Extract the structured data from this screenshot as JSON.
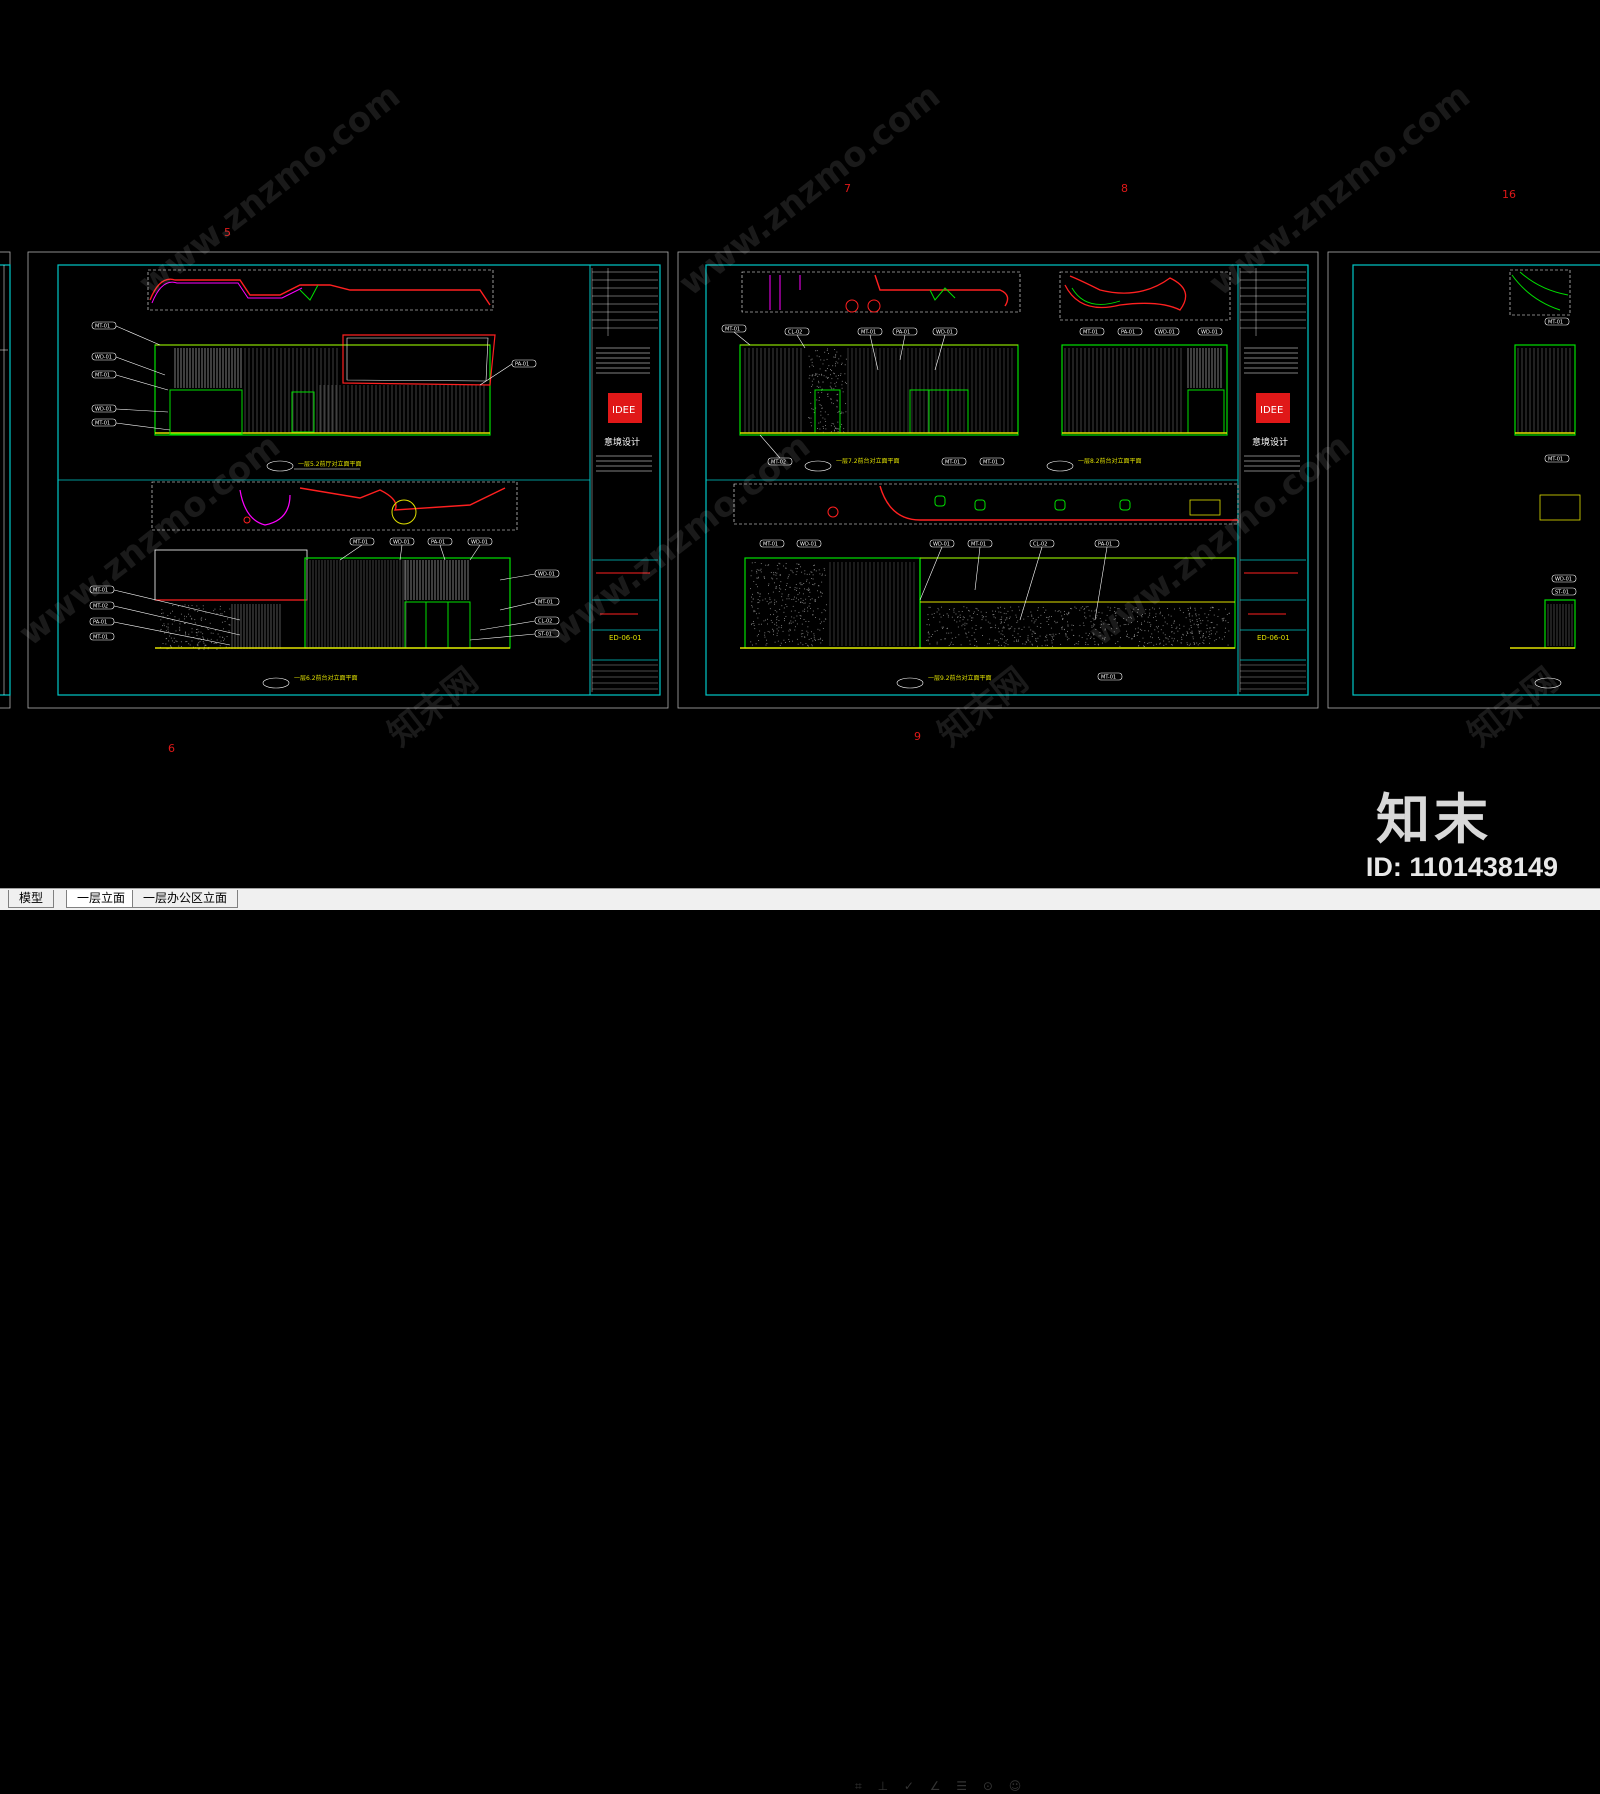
{
  "app": {
    "title": "CAD layout view"
  },
  "sheet_numbers": [
    "5",
    "6",
    "7",
    "8",
    "9",
    "16"
  ],
  "sheet_titles": {
    "s5": "一层5.2前厅对立面平面",
    "s6": "一层6.2前台对立面平面",
    "s7": "一层7.2前台对立面平面",
    "s8": "一层8.2前台对立面平面",
    "s9": "一层9.2前台对立面平面"
  },
  "brand_text": "意境设计",
  "brand_logo": "IDEE",
  "sheet_code_1": "ED-06-01",
  "sheet_code_2": "ED-06-01",
  "material_tags": [
    "MT-01",
    "WD-01",
    "PA-01",
    "CL-02",
    "ST-01",
    "MT-02"
  ],
  "watermark_text": "www.znzmo.com",
  "watermark_cn": "知末网",
  "logo_mark": "知末",
  "id_label": "ID: 1101438149",
  "tabs": [
    {
      "label": "模型"
    },
    {
      "label": "一层立面"
    },
    {
      "label": "一层办公区立面"
    }
  ],
  "status_hint": "⌗ ⊥ ✓ ∠ ☰ ⊙ ☺",
  "colors": {
    "background": "#000000",
    "frame": "#00c8c8",
    "elevation": "#00e000",
    "yellow": "#e0e000",
    "red": "#ff2020",
    "magenta": "#ff00ff",
    "sheet_number": "#e01818"
  }
}
